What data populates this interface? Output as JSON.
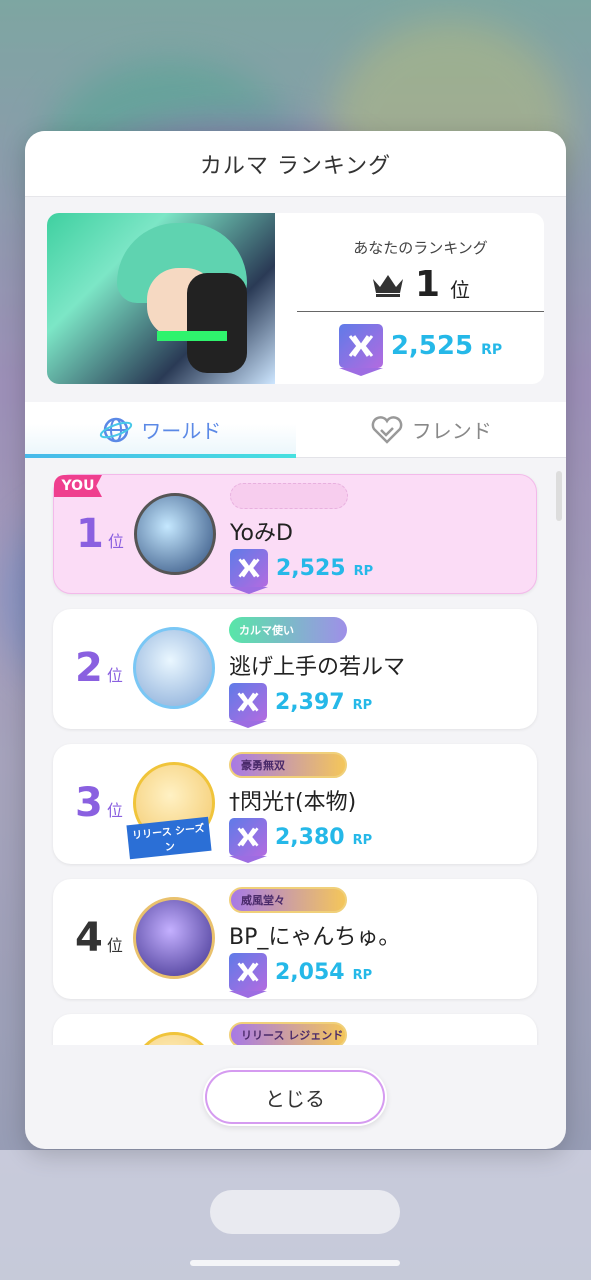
{
  "modal": {
    "title": "カルマ ランキング",
    "close_label": "とじる"
  },
  "hero": {
    "label": "あなたのランキング",
    "rank": "1",
    "rank_unit": "位",
    "points": "2,525",
    "points_unit": "RP"
  },
  "tabs": [
    {
      "label": "ワールド",
      "active": true,
      "icon": "globe-icon"
    },
    {
      "label": "フレンド",
      "active": false,
      "icon": "handshake-icon"
    }
  ],
  "ranking": [
    {
      "rank": "1",
      "rank_unit": "位",
      "name": "YoみD",
      "points": "2,525",
      "points_unit": "RP",
      "you_tag": "YOU",
      "title": ""
    },
    {
      "rank": "2",
      "rank_unit": "位",
      "name": "逃げ上手の若ルマ",
      "points": "2,397",
      "points_unit": "RP",
      "title": "カルマ使い"
    },
    {
      "rank": "3",
      "rank_unit": "位",
      "name": "†閃光†(本物)",
      "points": "2,380",
      "points_unit": "RP",
      "title": "豪勇無双",
      "frame_text": "リリース シーズン"
    },
    {
      "rank": "4",
      "rank_unit": "位",
      "name": "BP_にゃんちゅ。",
      "points": "2,054",
      "points_unit": "RP",
      "title": "威風堂々"
    },
    {
      "title": "リリース レジェンド"
    }
  ],
  "colors": {
    "accent_blue": "#25b8e8",
    "rank_purple": "#8a60e0",
    "you_pink": "#ef3f8e",
    "highlight_row": "#fbdcf6"
  }
}
